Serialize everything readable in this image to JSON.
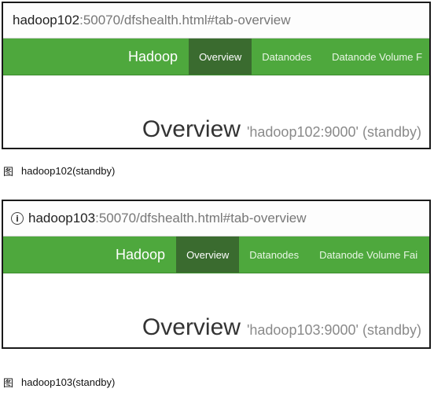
{
  "screenshots": [
    {
      "url": {
        "host": "hadoop102",
        "rest": ":50070/dfshealth.html#tab-overview"
      },
      "nav": {
        "brand": "Hadoop",
        "items": [
          "Overview",
          "Datanodes",
          "Datanode Volume F"
        ]
      },
      "heading": {
        "title": "Overview",
        "subtitle": "'hadoop102:9000' (standby)"
      },
      "caption": {
        "prefix": "图",
        "text": "hadoop102(standby)"
      }
    },
    {
      "url": {
        "host": "hadoop103",
        "rest": ":50070/dfshealth.html#tab-overview"
      },
      "nav": {
        "brand": "Hadoop",
        "items": [
          "Overview",
          "Datanodes",
          "Datanode Volume Fai"
        ]
      },
      "heading": {
        "title": "Overview",
        "subtitle": "'hadoop103:9000' (standby)"
      },
      "caption": {
        "prefix": "图",
        "text": "hadoop103(standby)"
      }
    }
  ],
  "colors": {
    "navbar": "#4ea83d",
    "nav_active": "#3a6b2f"
  },
  "icons": {
    "first_lead": "page-info-icon-clipped",
    "second_lead": "info-icon"
  }
}
